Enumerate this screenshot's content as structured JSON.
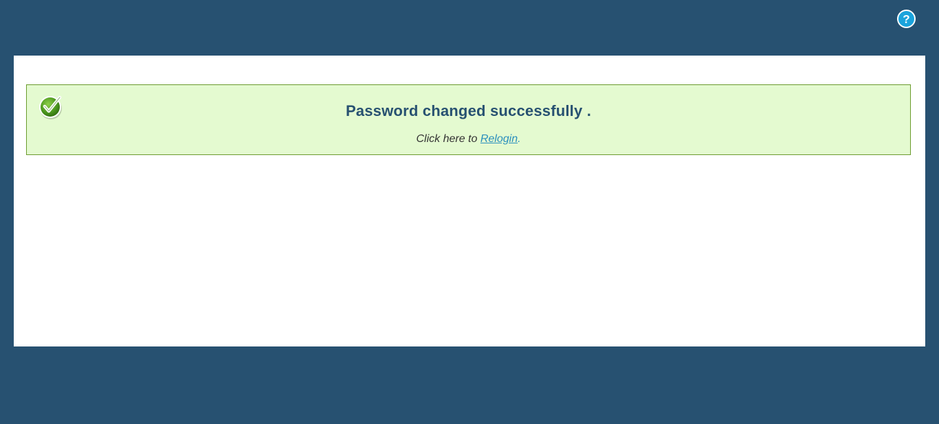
{
  "header": {
    "help_icon": "question-circle-icon",
    "help_color": "#1aa3dc"
  },
  "message": {
    "status_icon": "checkmark-icon",
    "title": "Password changed successfully .",
    "prompt_text": "Click here to ",
    "link_label": "Relogin",
    "suffix": ".",
    "box_background": "#e4fad0",
    "box_border": "#6a9a2c",
    "title_color": "#275171"
  },
  "theme": {
    "page_background": "#275171",
    "panel_background": "#ffffff"
  }
}
